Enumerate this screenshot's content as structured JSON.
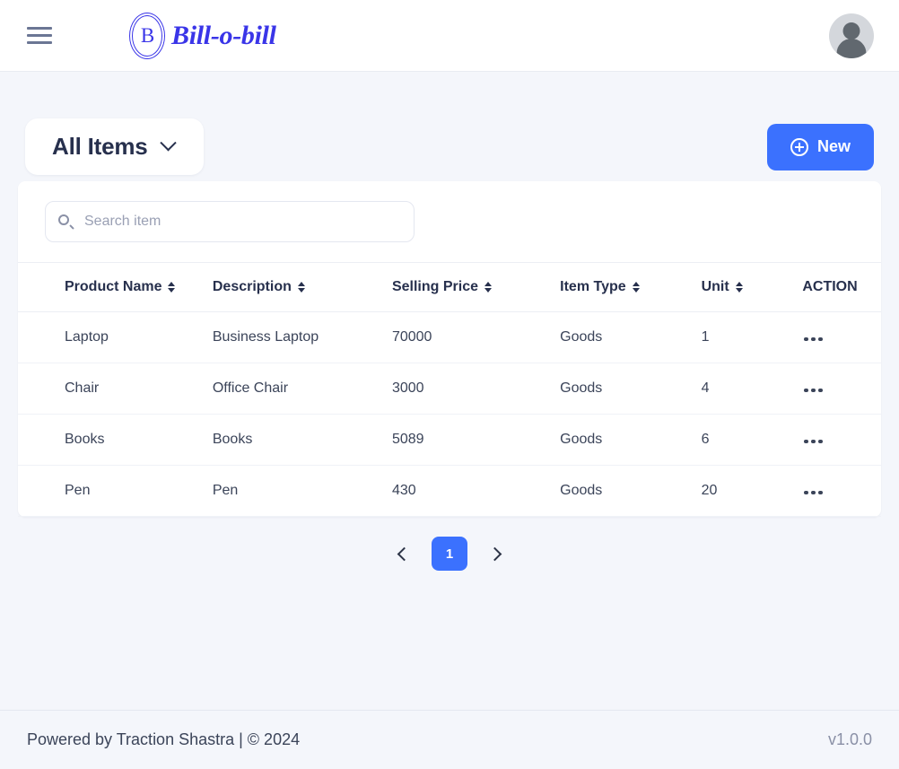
{
  "navbar": {
    "menu_icon": "hamburger-icon",
    "brand_letter": "B",
    "brand_name": "Bill-o-bill",
    "avatar_icon": "user-avatar-placeholder"
  },
  "toolbar": {
    "dropdown_label": "All Items",
    "dropdown_icon": "chevron-down-icon",
    "new_button_label": "New",
    "new_button_icon": "plus-circle-icon",
    "new_button_color": "#3b71fe"
  },
  "search": {
    "icon": "search-icon",
    "value": "",
    "placeholder": "Search item"
  },
  "table": {
    "columns": [
      {
        "label": "Product Name",
        "sortable": true
      },
      {
        "label": "Description",
        "sortable": true
      },
      {
        "label": "Selling Price",
        "sortable": true
      },
      {
        "label": "Item Type",
        "sortable": true
      },
      {
        "label": "Unit",
        "sortable": true
      },
      {
        "label": "ACTION",
        "sortable": false
      }
    ],
    "rows": [
      {
        "product_name": "Laptop",
        "description": "Business Laptop",
        "selling_price": "70000",
        "item_type": "Goods",
        "unit": "1",
        "action_icon": "ellipsis-icon"
      },
      {
        "product_name": "Chair",
        "description": "Office Chair",
        "selling_price": "3000",
        "item_type": "Goods",
        "unit": "4",
        "action_icon": "ellipsis-icon"
      },
      {
        "product_name": "Books",
        "description": "Books",
        "selling_price": "5089",
        "item_type": "Goods",
        "unit": "6",
        "action_icon": "ellipsis-icon"
      },
      {
        "product_name": "Pen",
        "description": "Pen",
        "selling_price": "430",
        "item_type": "Goods",
        "unit": "20",
        "action_icon": "ellipsis-icon"
      }
    ]
  },
  "pagination": {
    "prev_icon": "chevron-left-icon",
    "next_icon": "chevron-right-icon",
    "pages": [
      "1"
    ],
    "current_page": "1"
  },
  "footer": {
    "left_text": "Powered by Traction Shastra | © 2024",
    "version": "v1.0.0"
  },
  "theme": {
    "accent": "#3b71fe",
    "brand": "#3a35e8",
    "background": "#f4f6fb",
    "text": "#27304d"
  }
}
